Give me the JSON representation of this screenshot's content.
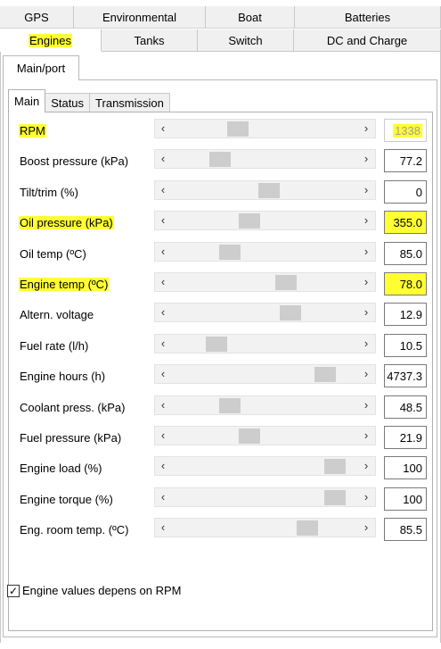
{
  "tabs_row1": [
    {
      "label": "GPS",
      "width": 83
    },
    {
      "label": "Environmental",
      "width": 148
    },
    {
      "label": "Boat",
      "width": 100
    },
    {
      "label": "Batteries",
      "width": 164
    }
  ],
  "tabs_row2": [
    {
      "label": "Engines",
      "width": 114,
      "active": true
    },
    {
      "label": "Tanks",
      "width": 108
    },
    {
      "label": "Switch",
      "width": 108
    },
    {
      "label": "DC and Charge",
      "width": 165
    }
  ],
  "panel_tab": "Main/port",
  "inner_tabs": [
    "Main",
    "Status",
    "Transmission"
  ],
  "rows": [
    {
      "label": "RPM",
      "value": "1338",
      "pos": 0.33,
      "highlight": true,
      "disabled": true
    },
    {
      "label": "Boost pressure (kPa)",
      "value": "77.2",
      "pos": 0.22
    },
    {
      "label": "Tilt/trim (%)",
      "value": "0",
      "pos": 0.52
    },
    {
      "label": "Oil pressure (kPa)",
      "value": "355.0",
      "pos": 0.4,
      "highlight": true
    },
    {
      "label": "Oil temp (ºC)",
      "value": "85.0",
      "pos": 0.28
    },
    {
      "label": "Engine temp (ºC)",
      "value": "78.0",
      "pos": 0.62,
      "highlight": true
    },
    {
      "label": "Altern. voltage",
      "value": "12.9",
      "pos": 0.65
    },
    {
      "label": "Fuel rate (l/h)",
      "value": "10.5",
      "pos": 0.2
    },
    {
      "label": "Engine hours (h)",
      "value": "4737.3",
      "pos": 0.86
    },
    {
      "label": "Coolant press. (kPa)",
      "value": "48.5",
      "pos": 0.28
    },
    {
      "label": "Fuel pressure (kPa)",
      "value": "21.9",
      "pos": 0.4
    },
    {
      "label": "Engine load (%)",
      "value": "100",
      "pos": 0.92
    },
    {
      "label": "Engine torque (%)",
      "value": "100",
      "pos": 0.92
    },
    {
      "label": "Eng. room temp. (ºC)",
      "value": "85.5",
      "pos": 0.75
    }
  ],
  "checkbox": {
    "label": "Engine values depens on RPM",
    "checked": true
  },
  "colors": {
    "highlight": "#ffff33",
    "thumb": "#cdcdcd",
    "track": "#f2f2f2"
  }
}
